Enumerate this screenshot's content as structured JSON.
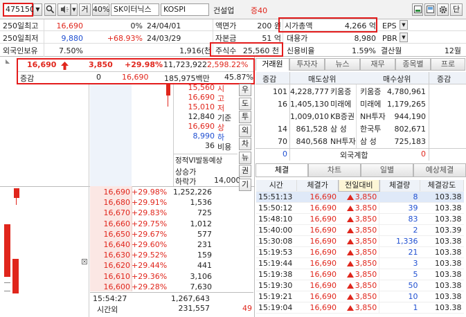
{
  "toolbar": {
    "stock_code": "475150",
    "dropdown_symbol": "▼",
    "search_icon": "search-icon",
    "speaker_icon": "speaker-icon",
    "geo_label": "거",
    "percent_label": "40%",
    "stock_name": "SK이터닉스",
    "market": "KOSPI",
    "industry": "건설업",
    "margin_label": "증40",
    "minimize_icon": "minimize-icon",
    "settings_icon": "gear-icon",
    "single_label": "단"
  },
  "info": {
    "row1": {
      "label": "250일최고",
      "value": "16,690",
      "pct": "0%",
      "date": "24/04/01",
      "k2": "액면가",
      "v2": "200 원",
      "k3": "시가총액",
      "v3": "4,266 억",
      "k4": "EPS"
    },
    "row2": {
      "label": "250일최저",
      "value": "9,880",
      "pct": "+68.93%",
      "date": "24/03/29",
      "k2": "자본금",
      "v2": "51 억",
      "k3": "대용가",
      "v3": "8,980",
      "k4": "PBR"
    },
    "row3": {
      "label": "외국인보유",
      "value": "7.50%",
      "extra": "1,916(천",
      "k2": "주식수",
      "v2": "25,560 천",
      "k3": "신용비율",
      "v3": "1.59%",
      "k4": "결산월",
      "v4": "12월"
    }
  },
  "price": {
    "current": "16,690",
    "change": "3,850",
    "rate": "+29.98%",
    "volume": "11,723,922",
    "vol_rate": "2,598.22%",
    "label_change": "증감",
    "zero": "0",
    "price2": "16,690",
    "amount": "185,975백만",
    "ratio": "45.87%"
  },
  "summary": [
    {
      "value": "15,560",
      "label": "시",
      "color": "#e0261c"
    },
    {
      "value": "16,690",
      "label": "고",
      "color": "#e0261c"
    },
    {
      "value": "15,010",
      "label": "저",
      "color": "#e0261c"
    },
    {
      "value": "12,840",
      "label": "기준",
      "color": "#222"
    },
    {
      "value": "16,690",
      "label": "상",
      "color": "#e0261c"
    },
    {
      "value": "8,990",
      "label": "하",
      "color": "#1f4fd1"
    },
    {
      "value": "36",
      "label": "비용",
      "color": "#222"
    }
  ],
  "vi": {
    "title": "정적VI발동예상",
    "up": "상승가",
    "down": "하락가",
    "down_val": "14,000"
  },
  "side_buttons": [
    "우",
    "도",
    "투",
    "외",
    "차",
    "뉴",
    "권",
    "기"
  ],
  "bids": [
    {
      "price": "16,690",
      "rate": "+29.98%",
      "qty": "1,252,226"
    },
    {
      "price": "16,680",
      "rate": "+29.91%",
      "qty": "1,536"
    },
    {
      "price": "16,670",
      "rate": "+29.83%",
      "qty": "725"
    },
    {
      "price": "16,660",
      "rate": "+29.75%",
      "qty": "1,012"
    },
    {
      "price": "16,650",
      "rate": "+29.67%",
      "qty": "577"
    },
    {
      "price": "16,640",
      "rate": "+29.60%",
      "qty": "231"
    },
    {
      "price": "16,630",
      "rate": "+29.52%",
      "qty": "159"
    },
    {
      "price": "16,620",
      "rate": "+29.44%",
      "qty": "441"
    },
    {
      "price": "16,610",
      "rate": "+29.36%",
      "qty": "3,106"
    },
    {
      "price": "16,600",
      "rate": "+29.28%",
      "qty": "7,630"
    }
  ],
  "bottom": {
    "time": "15:54:27",
    "label": "시간외",
    "total": "1,267,643",
    "total2": "231,557",
    "after": "49"
  },
  "right_tabs": [
    "거래원",
    "투자자",
    "뉴스",
    "재무",
    "종목별",
    "프로"
  ],
  "broker": {
    "h_change": "증감",
    "h_sell": "매도상위",
    "h_buy": "매수상위",
    "h_change2": "증감",
    "rows": [
      {
        "chg": "101",
        "sell_qty": "4,228,777",
        "sell_name": "키움증",
        "buy_name": "키움증",
        "buy_qty": "4,780,961",
        "chg2": ""
      },
      {
        "chg": "16",
        "sell_qty": "1,405,130",
        "sell_name": "미래에",
        "buy_name": "미래에",
        "buy_qty": "1,179,265",
        "chg2": ""
      },
      {
        "chg": "",
        "sell_qty": "1,009,010",
        "sell_name": "KB증권",
        "buy_name": "NH투자",
        "buy_qty": "944,190",
        "chg2": ""
      },
      {
        "chg": "14",
        "sell_qty": "861,528",
        "sell_name": "삼 성",
        "buy_name": "한국투",
        "buy_qty": "802,671",
        "chg2": ""
      },
      {
        "chg": "70",
        "sell_qty": "840,568",
        "sell_name": "NH투자",
        "buy_name": "삼 성",
        "buy_qty": "725,183",
        "chg2": ""
      }
    ],
    "foreign_left": "0",
    "foreign_label": "외국계합",
    "foreign_right": "0"
  },
  "bottom_tabs": [
    "체결",
    "차트",
    "일별",
    "예상체결"
  ],
  "trades": {
    "headers": [
      "시간",
      "체결가",
      "전일대비",
      "체결량",
      "체결강도"
    ],
    "rows": [
      {
        "time": "15:51:13",
        "price": "16,690",
        "diff": "3,850",
        "qty": "8",
        "strength": "103.38"
      },
      {
        "time": "15:50:12",
        "price": "16,690",
        "diff": "3,850",
        "qty": "39",
        "strength": "103.38"
      },
      {
        "time": "15:48:10",
        "price": "16,690",
        "diff": "3,850",
        "qty": "83",
        "strength": "103.38"
      },
      {
        "time": "15:40:00",
        "price": "16,690",
        "diff": "3,850",
        "qty": "2",
        "strength": "103.39"
      },
      {
        "time": "15:30:08",
        "price": "16,690",
        "diff": "3,850",
        "qty": "1,336",
        "strength": "103.38"
      },
      {
        "time": "15:19:53",
        "price": "16,690",
        "diff": "3,850",
        "qty": "21",
        "strength": "103.38"
      },
      {
        "time": "15:19:44",
        "price": "16,690",
        "diff": "3,850",
        "qty": "3",
        "strength": "103.38"
      },
      {
        "time": "15:19:38",
        "price": "16,690",
        "diff": "3,850",
        "qty": "5",
        "strength": "103.38"
      },
      {
        "time": "15:19:30",
        "price": "16,690",
        "diff": "3,850",
        "qty": "50",
        "strength": "103.38"
      },
      {
        "time": "15:19:21",
        "price": "16,690",
        "diff": "3,850",
        "qty": "10",
        "strength": "103.38"
      },
      {
        "time": "15:19:04",
        "price": "16,690",
        "diff": "3,850",
        "qty": "1",
        "strength": "103.38"
      }
    ]
  },
  "colors": {
    "up": "#e0261c",
    "down": "#1f4fd1",
    "highlight": "#e31b1b"
  }
}
